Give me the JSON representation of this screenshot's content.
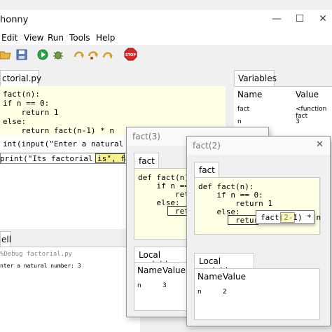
{
  "window": {
    "title": "honny",
    "minimize": "—",
    "maximize": "☐",
    "close": "✕"
  },
  "menu": [
    "Edit",
    "View",
    "Run",
    "Tools",
    "Help"
  ],
  "toolbar": {
    "icons": [
      "open-icon",
      "save-icon",
      "run-icon",
      "debug-icon",
      "step-over-icon",
      "step-into-icon",
      "step-out-icon",
      "stop-icon"
    ],
    "stop_label": "STOP",
    "colors": {
      "run": "#2ea34a",
      "stop": "#d62a2a",
      "open": "#e8b640",
      "save": "#5a7fc0",
      "step": "#d89a2a"
    }
  },
  "editor": {
    "tab_label": "ctorial.py",
    "lines": [
      "fact(n):",
      "if n == 0:",
      "    return 1",
      "else:",
      "    return fact(n-1) * n",
      "",
      "int(input(\"Enter a natural number",
      "",
      "print(\"Its factorial is\", fact(3))"
    ],
    "current_call": "fact(3)"
  },
  "shell": {
    "tab_label": "ell",
    "lines": [
      "%Debug factorial.py",
      "nter a natural number: 3"
    ]
  },
  "variables": {
    "tab_label": "Variables",
    "headers": [
      "Name",
      "Value"
    ],
    "rows": [
      {
        "name": "fact",
        "value": "<function fact"
      },
      {
        "name": "n",
        "value": "3"
      }
    ]
  },
  "debug_frames": [
    {
      "title": "fact(3)",
      "tab_label": "fact",
      "code": [
        "def fact(n):",
        "    if n == 0",
        "        retur",
        "    else:",
        "        retur"
      ],
      "locals_tab": "Local variables",
      "headers": [
        "Name",
        "Value"
      ],
      "rows": [
        {
          "name": "n",
          "value": "3"
        }
      ]
    },
    {
      "title": "fact(2)",
      "tab_label": "fact",
      "code": [
        "def fact(n):",
        "    if n == 0:",
        "        return 1",
        "    else:",
        "        return"
      ],
      "popup_expr": "fact(2-1) * n",
      "locals_tab": "Local variables",
      "headers": [
        "Name",
        "Value"
      ],
      "rows": [
        {
          "name": "n",
          "value": "2"
        }
      ],
      "close": "✕"
    }
  ]
}
